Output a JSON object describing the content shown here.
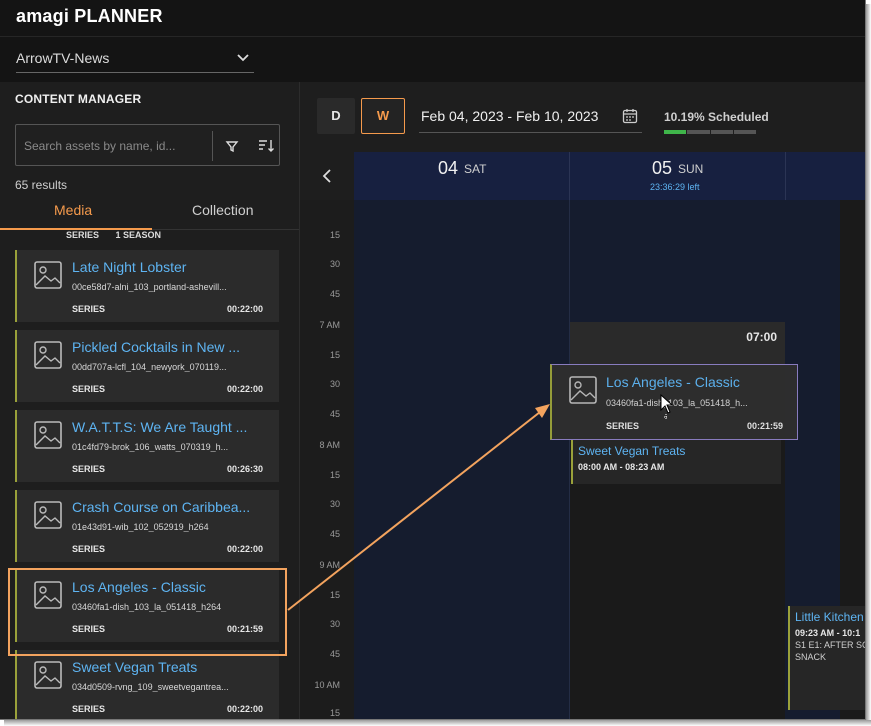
{
  "app": {
    "logo_brand": "amagi",
    "logo_product": "PLANNER"
  },
  "channel": {
    "selected": "ArrowTV-News"
  },
  "content_manager": {
    "title": "CONTENT MANAGER",
    "search_placeholder": "Search assets by name, id...",
    "results": "65 results",
    "tabs": [
      {
        "label": "Media",
        "active": true
      },
      {
        "label": "Collection",
        "active": false
      }
    ],
    "partial_row": {
      "type": "SERIES",
      "extra": "1 SEASON"
    },
    "items": [
      {
        "title": "Late Night Lobster",
        "id": "00ce58d7-alni_103_portland-ashevill...",
        "type": "SERIES",
        "duration": "00:22:00"
      },
      {
        "title": "Pickled Cocktails in New ...",
        "id": "00dd707a-lcfl_104_newyork_070119...",
        "type": "SERIES",
        "duration": "00:22:00"
      },
      {
        "title": "W.A.T.T.S: We Are Taught ...",
        "id": "01c4fd79-brok_106_watts_070319_h...",
        "type": "SERIES",
        "duration": "00:26:30"
      },
      {
        "title": "Crash Course on Caribbea...",
        "id": "01e43d91-wib_102_052919_h264",
        "type": "SERIES",
        "duration": "00:22:00"
      },
      {
        "title": "Los Angeles - Classic",
        "id": "03460fa1-dish_103_la_051418_h264",
        "type": "SERIES",
        "duration": "00:21:59"
      },
      {
        "title": "Sweet Vegan Treats",
        "id": "034d0509-rvng_109_sweetvegantrea...",
        "type": "SERIES",
        "duration": "00:22:00"
      }
    ]
  },
  "planner": {
    "view_day": "D",
    "view_week": "W",
    "date_range": "Feb 04, 2023 - Feb 10, 2023",
    "scheduled": "10.19% Scheduled",
    "scheduled_fraction": 0.1019,
    "days": [
      {
        "num": "04",
        "name": "SAT",
        "left": ""
      },
      {
        "num": "05",
        "name": "SUN",
        "left": "23:36:29 left"
      }
    ],
    "time_labels": [
      "15",
      "30",
      "45",
      "7 AM",
      "15",
      "30",
      "45",
      "8 AM",
      "15",
      "30",
      "45",
      "9 AM",
      "15",
      "30",
      "45",
      "10 AM",
      "15"
    ],
    "booked_start": "07:00",
    "events": [
      {
        "title": "Sweet Vegan Treats",
        "time": "08:00 AM - 08:23 AM"
      },
      {
        "title": "Little Kitchen",
        "time": "09:23 AM - 10:1",
        "line3": "S1 E1: AFTER SC",
        "line4": "SNACK"
      }
    ],
    "dragging": {
      "title": "Los Angeles - Classic",
      "id": "03460fa1-dish_103_la_051418_h...",
      "type": "SERIES",
      "duration": "00:21:59"
    }
  },
  "colors": {
    "accent": "#f59a4c",
    "link": "#5eb4f2",
    "scheduled": "#3fb54a",
    "annotation": "#f3a35e"
  }
}
